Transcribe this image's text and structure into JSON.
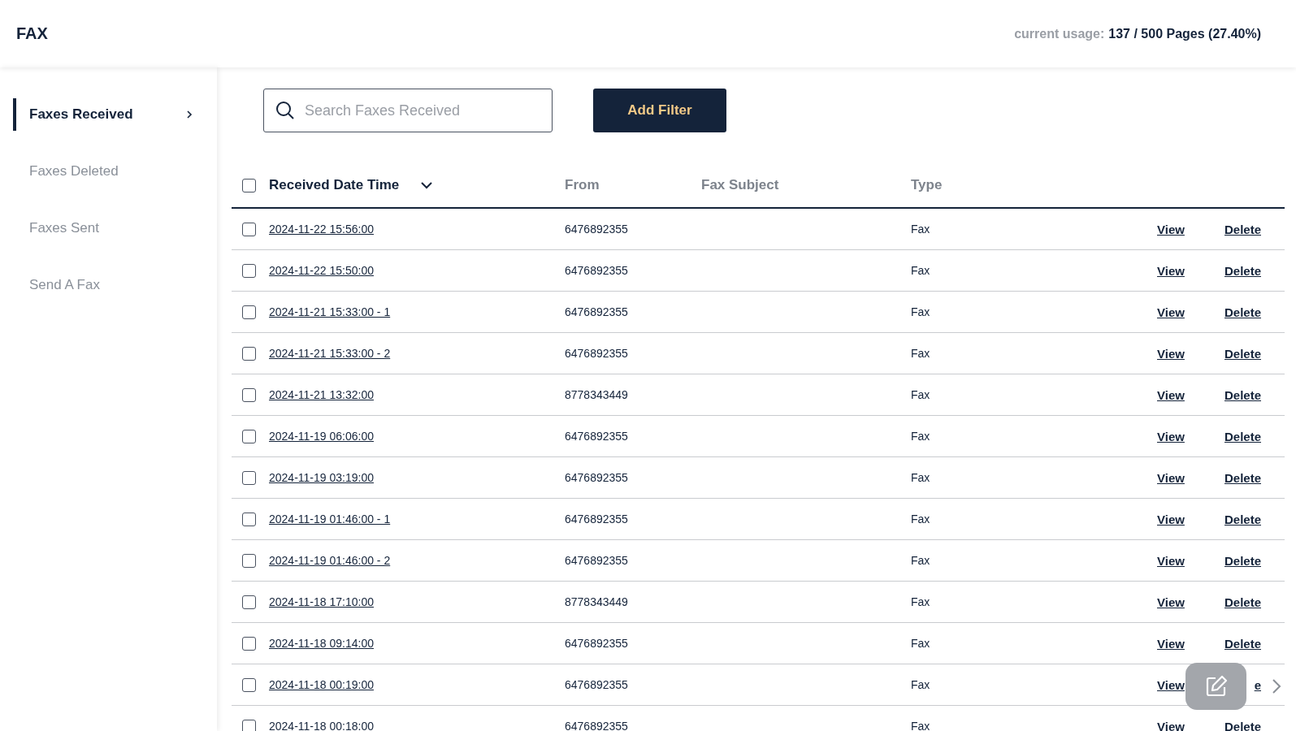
{
  "header": {
    "title": "FAX",
    "usage_label": "current usage:",
    "usage_value": "137 / 500 Pages (27.40%)"
  },
  "sidebar": {
    "items": [
      {
        "label": "Faxes Received",
        "selected": true
      },
      {
        "label": "Faxes Deleted",
        "selected": false
      },
      {
        "label": "Faxes Sent",
        "selected": false
      },
      {
        "label": "Send A Fax",
        "selected": false
      }
    ]
  },
  "search": {
    "placeholder": "Search Faxes Received"
  },
  "add_filter": "Add Filter",
  "table": {
    "select_all_checked": false,
    "columns": [
      "Received Date Time",
      "From",
      "Fax Subject",
      "Type"
    ],
    "rows": [
      {
        "checked": false,
        "date": "2024-11-22 15:56:00",
        "from": "6476892355",
        "type": "Fax",
        "view": "View",
        "delete": "Delete"
      },
      {
        "checked": false,
        "date": "2024-11-22 15:50:00",
        "from": "6476892355",
        "type": "Fax",
        "view": "View",
        "delete": "Delete"
      },
      {
        "checked": false,
        "date": "2024-11-21 15:33:00 - 1",
        "from": "6476892355",
        "type": "Fax",
        "view": "View",
        "delete": "Delete"
      },
      {
        "checked": false,
        "date": "2024-11-21 15:33:00 - 2",
        "from": "6476892355",
        "type": "Fax",
        "view": "View",
        "delete": "Delete"
      },
      {
        "checked": false,
        "date": "2024-11-21 13:32:00",
        "from": "8778343449",
        "type": "Fax",
        "view": "View",
        "delete": "Delete"
      },
      {
        "checked": false,
        "date": "2024-11-19 06:06:00",
        "from": "6476892355",
        "type": "Fax",
        "view": "View",
        "delete": "Delete"
      },
      {
        "checked": false,
        "date": "2024-11-19 03:19:00",
        "from": "6476892355",
        "type": "Fax",
        "view": "View",
        "delete": "Delete"
      },
      {
        "checked": false,
        "date": "2024-11-19 01:46:00 - 1",
        "from": "6476892355",
        "type": "Fax",
        "view": "View",
        "delete": "Delete"
      },
      {
        "checked": false,
        "date": "2024-11-19 01:46:00 - 2",
        "from": "6476892355",
        "type": "Fax",
        "view": "View",
        "delete": "Delete"
      },
      {
        "checked": false,
        "date": "2024-11-18 17:10:00",
        "from": "8778343449",
        "type": "Fax",
        "view": "View",
        "delete": "Delete"
      },
      {
        "checked": false,
        "date": "2024-11-18 09:14:00",
        "from": "6476892355",
        "type": "Fax",
        "view": "View",
        "delete": "Delete"
      },
      {
        "checked": false,
        "date": "2024-11-18 00:19:00",
        "from": "6476892355",
        "type": "Fax",
        "view": "View",
        "delete": "e"
      },
      {
        "checked": false,
        "date": "2024-11-18 00:18:00",
        "from": "6476892355",
        "type": "Fax",
        "view": "View",
        "delete": "Delete"
      }
    ]
  }
}
